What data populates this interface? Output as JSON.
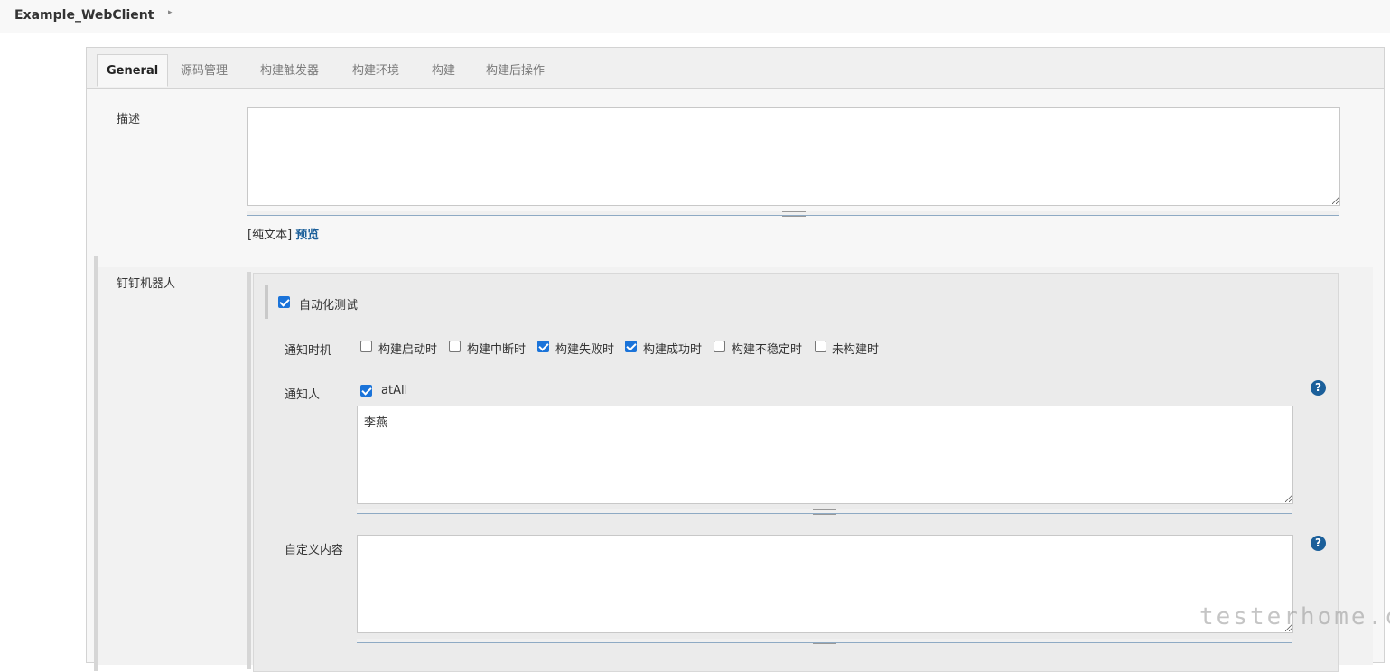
{
  "header": {
    "title": "Example_WebClient"
  },
  "tabs": [
    {
      "label": "General",
      "active": true
    },
    {
      "label": "源码管理",
      "active": false
    },
    {
      "label": "构建触发器",
      "active": false
    },
    {
      "label": "构建环境",
      "active": false
    },
    {
      "label": "构建",
      "active": false
    },
    {
      "label": "构建后操作",
      "active": false
    }
  ],
  "description": {
    "label": "描述",
    "value": "",
    "format_text": "[纯文本]",
    "preview_link": "预览"
  },
  "dingtalk": {
    "label": "钉钉机器人",
    "robot": {
      "name": "自动化测试",
      "enabled": true
    },
    "notify_timing": {
      "label": "通知时机",
      "options": [
        {
          "label": "构建启动时",
          "checked": false
        },
        {
          "label": "构建中断时",
          "checked": false
        },
        {
          "label": "构建失败时",
          "checked": true
        },
        {
          "label": "构建成功时",
          "checked": true
        },
        {
          "label": "构建不稳定时",
          "checked": false
        },
        {
          "label": "未构建时",
          "checked": false
        }
      ]
    },
    "notify_people": {
      "label": "通知人",
      "at_all_label": "atAll",
      "at_all_checked": true,
      "value": "李燕"
    },
    "custom_content": {
      "label": "自定义内容",
      "value": ""
    },
    "help_icon": "?"
  },
  "watermark": "testerhome.com"
}
